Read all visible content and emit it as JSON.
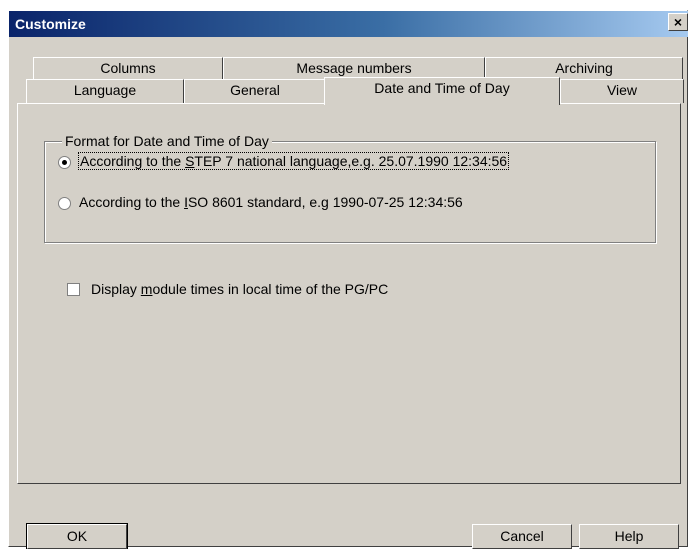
{
  "window": {
    "title": "Customize",
    "close_glyph": "×"
  },
  "tabs": {
    "row1": [
      {
        "label": "Columns"
      },
      {
        "label": "Message numbers"
      },
      {
        "label": "Archiving"
      }
    ],
    "row2": [
      {
        "label": "Language"
      },
      {
        "label": "General"
      },
      {
        "label": "Date and Time of Day",
        "selected": true
      },
      {
        "label": "View"
      }
    ]
  },
  "format_group": {
    "legend": "Format for Date and Time of Day",
    "options": [
      {
        "label_before": "According to the ",
        "label_mnemonic": "S",
        "label_after": "TEP 7 national language,e.g. 25.07.1990 12:34:56",
        "checked": true
      },
      {
        "label_before": "According to the ",
        "label_mnemonic": "I",
        "label_after": "SO 8601 standard, e.g 1990-07-25 12:34:56",
        "checked": false
      }
    ]
  },
  "module_times": {
    "label_before": "Display ",
    "label_mnemonic": "m",
    "label_after": "odule times in local time of the PG/PC",
    "checked": false
  },
  "buttons": {
    "ok": "OK",
    "cancel": "Cancel",
    "help": "Help"
  },
  "colors": {
    "face": "#d4d0c8",
    "title_start": "#0a246a",
    "title_end": "#a6caf0"
  }
}
